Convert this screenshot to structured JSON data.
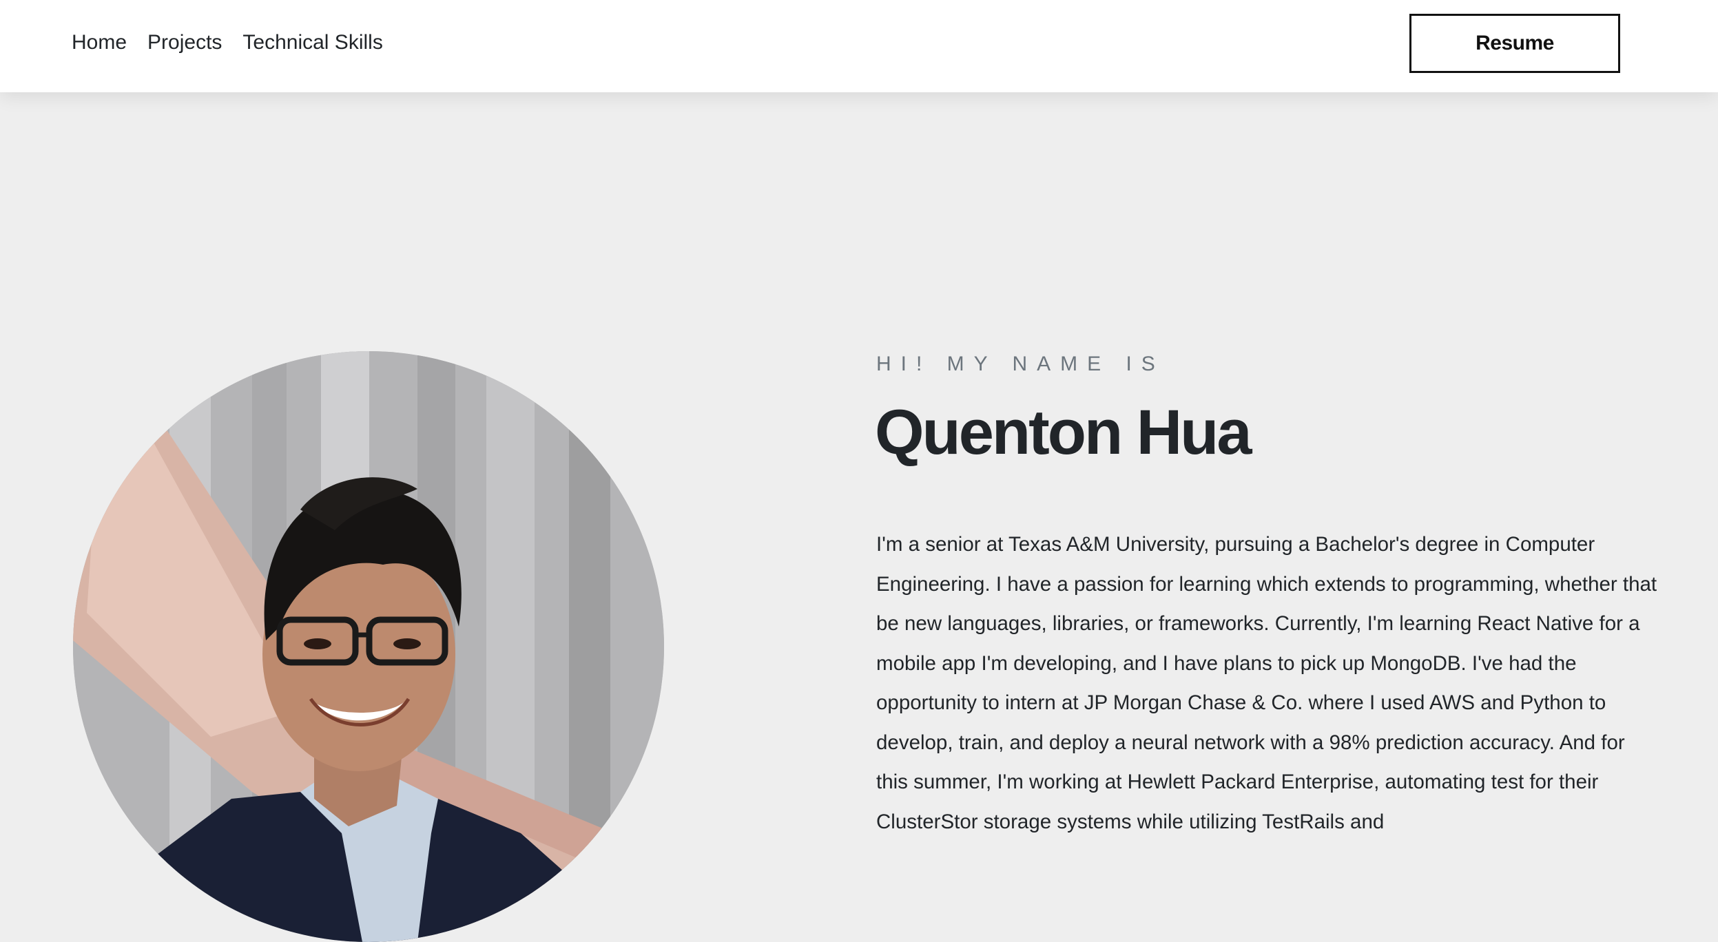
{
  "nav": {
    "links": [
      "Home",
      "Projects",
      "Technical Skills"
    ],
    "resume_label": "Resume"
  },
  "hero": {
    "eyebrow": "HI! MY NAME IS",
    "name": "Quenton Hua",
    "bio": "I'm a senior at Texas A&M University, pursuing a Bachelor's degree in Computer Engineering. I have a passion for learning which extends to programming, whether that be new languages, libraries, or frameworks. Currently, I'm learning React Native for a mobile app I'm developing, and I have plans to pick up MongoDB. I've had the opportunity to intern at JP Morgan Chase & Co. where I used AWS and Python to develop, train, and deploy a neural network with a 98% prediction accuracy. And for this summer, I'm working at Hewlett Packard Enterprise, automating test for their ClusterStor storage systems while utilizing TestRails and"
  },
  "colors": {
    "page_background": "#eeeeee",
    "navbar_background": "#ffffff",
    "text": "#212529",
    "muted_text": "#6c757d",
    "button_border": "#111111"
  }
}
